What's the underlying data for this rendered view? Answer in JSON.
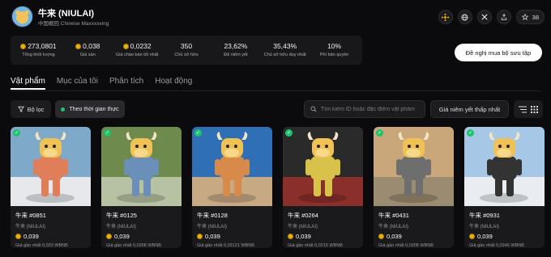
{
  "collection": {
    "title": "牛来 (NIULAI)",
    "subtitle": "中国概回 Chinese Maxxxxxing"
  },
  "header_icons": {
    "icons": [
      "binance-icon",
      "globe-icon",
      "x-icon",
      "share-icon",
      "star-icon"
    ],
    "favorite_count": "38"
  },
  "stats": [
    {
      "value": "273,0801",
      "label": "Tổng khối lượng",
      "coin": true
    },
    {
      "value": "0,038",
      "label": "Giá sàn",
      "coin": true
    },
    {
      "value": "0,0232",
      "label": "Giá chào bán tối nhất",
      "coin": true
    },
    {
      "value": "350",
      "label": "Chủ sở hữu",
      "coin": false
    },
    {
      "value": "23,62%",
      "label": "Đã niêm yết",
      "coin": false
    },
    {
      "value": "35,43%",
      "label": "Chủ sở hữu duy nhất",
      "coin": false
    },
    {
      "value": "10%",
      "label": "Phí bản quyền",
      "coin": false
    }
  ],
  "offer_button": "Đề nghị mua bộ sưu tập",
  "tabs": [
    {
      "label": "Vật phẩm",
      "active": true
    },
    {
      "label": "Mục của tôi",
      "active": false
    },
    {
      "label": "Phân tích",
      "active": false
    },
    {
      "label": "Hoạt động",
      "active": false
    }
  ],
  "toolbar": {
    "filter_label": "Bộ lọc",
    "live_label": "Theo thời gian thực",
    "search_placeholder": "Tìm kiếm ID hoặc đặc điểm vật phẩm",
    "sort_label": "Giá niêm yết thấp nhất"
  },
  "cards": [
    {
      "name": "牛来 #0851",
      "collection": "牛来 (NIULAI)",
      "price": "0,039",
      "last": "Giá gần nhất 0,033 WBNB",
      "bg": "#7fa9c9",
      "ground": "#e6e8ec",
      "body": "#e07e5a"
    },
    {
      "name": "牛来 #0125",
      "collection": "牛来 (NIULAI)",
      "price": "0,039",
      "last": "Giá gần nhất 0,0308 WBNB",
      "bg": "#6e8a4c",
      "ground": "#b7c2a2",
      "body": "#6a8fb8"
    },
    {
      "name": "牛来 #0128",
      "collection": "牛来 (NIULAI)",
      "price": "0,039",
      "last": "Giá gần nhất 0,03121 WBNB",
      "bg": "#2f6fb5",
      "ground": "#c7a984",
      "body": "#d88a4a"
    },
    {
      "name": "牛来 #0264",
      "collection": "牛来 (NIULAI)",
      "price": "0,039",
      "last": "Giá gần nhất 0,0215 WBNB",
      "bg": "#2a2a2a",
      "ground": "#8a2f2a",
      "body": "#d9c24a"
    },
    {
      "name": "牛来 #0431",
      "collection": "牛来 (NIULAI)",
      "price": "0,039",
      "last": "Giá gần nhất 0,0308 WBNB",
      "bg": "#c9a77a",
      "ground": "#9b8b70",
      "body": "#6e6e6e"
    },
    {
      "name": "牛来 #0931",
      "collection": "牛来 (NIULAI)",
      "price": "0,039",
      "last": "Giá gần nhất 0,0345 WBNB",
      "bg": "#a7c7e6",
      "ground": "#e9edf2",
      "body": "#333333"
    }
  ]
}
